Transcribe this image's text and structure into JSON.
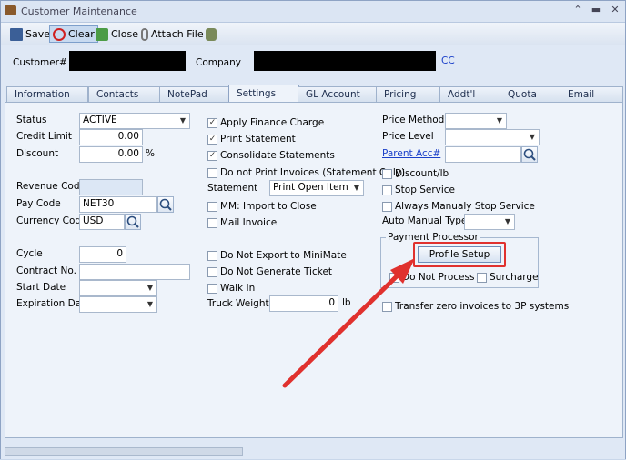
{
  "window": {
    "title": "Customer Maintenance"
  },
  "toolbar": {
    "save": "Save",
    "clear": "Clear",
    "close": "Close",
    "attach": "Attach File"
  },
  "header": {
    "customer_label": "Customer#",
    "company_label": "Company",
    "cc_link": "CC"
  },
  "tabs": [
    "Information",
    "Contacts",
    "NotePad",
    "Settings",
    "GL Account",
    "Pricing",
    "Addt'l",
    "Quota",
    "Email"
  ],
  "active_tab": "Settings",
  "left": {
    "status_label": "Status",
    "status_value": "ACTIVE",
    "credit_limit_label": "Credit Limit",
    "credit_limit_value": "0.00",
    "discount_label": "Discount",
    "discount_value": "0.00",
    "discount_unit": "%",
    "revenue_code_label": "Revenue Code",
    "pay_code_label": "Pay Code",
    "pay_code_value": "NET30",
    "currency_code_label": "Currency Code",
    "currency_code_value": "USD",
    "cycle_label": "Cycle",
    "cycle_value": "0",
    "contract_no_label": "Contract No.",
    "start_date_label": "Start Date",
    "expiration_date_label": "Expiration Date"
  },
  "middle": {
    "apply_finance_charge": "Apply Finance Charge",
    "print_statement": "Print Statement",
    "consolidate_statements": "Consolidate Statements",
    "do_not_print_invoices": "Do not Print Invoices (Statement Only)",
    "statement_label": "Statement",
    "statement_value": "Print Open Item",
    "mm_import": "MM:  Import to Close",
    "mail_invoice": "Mail Invoice",
    "do_not_export": "Do Not Export to MiniMate",
    "do_not_generate_ticket": "Do Not Generate Ticket",
    "walk_in": "Walk In",
    "truck_weight_label": "Truck Weight",
    "truck_weight_value": "0",
    "truck_weight_unit": "lb"
  },
  "right": {
    "price_method_label": "Price Method",
    "price_level_label": "Price Level",
    "parent_acc_label": "Parent Acc#",
    "discount_lb": "Discount/lb",
    "stop_service": "Stop Service",
    "always_manualy_stop": "Always Manualy Stop Service",
    "auto_manual_types_label": "Auto Manual Types",
    "payment_processor_label": "Payment Processor",
    "profile_setup": "Profile Setup",
    "do_not_process": "Do Not Process",
    "surcharge": "Surcharge",
    "transfer_zero": "Transfer zero invoices to 3P systems"
  },
  "colors": {
    "highlight": "#e0312e",
    "arrow": "#e0312e",
    "link": "#1a3fc9"
  }
}
